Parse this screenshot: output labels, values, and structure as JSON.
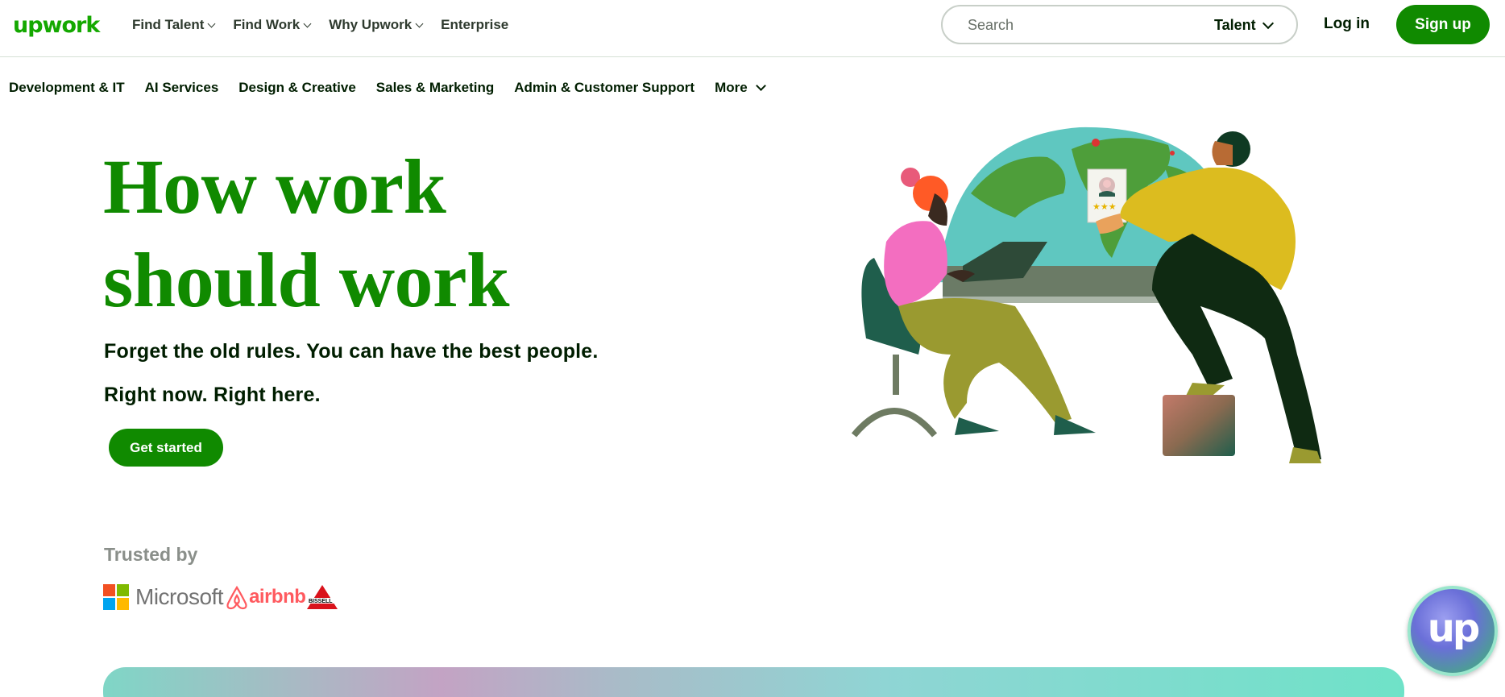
{
  "header": {
    "logo_text": "upwork",
    "nav": [
      {
        "label": "Find Talent",
        "has_menu": true
      },
      {
        "label": "Find Work",
        "has_menu": true
      },
      {
        "label": "Why Upwork",
        "has_menu": true
      },
      {
        "label": "Enterprise",
        "has_menu": false
      }
    ],
    "search": {
      "placeholder": "Search",
      "scope": "Talent"
    },
    "login_label": "Log in",
    "signup_label": "Sign up"
  },
  "categories": [
    "Development & IT",
    "AI Services",
    "Design & Creative",
    "Sales & Marketing",
    "Admin & Customer Support",
    "More"
  ],
  "hero": {
    "title_line1": "How work",
    "title_line2": "should work",
    "subtitle_line1": "Forget the old rules. You can have the best people.",
    "subtitle_line2": "Right now. Right here.",
    "cta_label": "Get started"
  },
  "trusted": {
    "heading": "Trusted by",
    "logos": [
      "Microsoft",
      "airbnb",
      "BISSELL"
    ]
  },
  "chat_widget": {
    "label": "up"
  },
  "colors": {
    "brand_green": "#108a00",
    "logo_green": "#14a800",
    "text_dark": "#001e00"
  }
}
